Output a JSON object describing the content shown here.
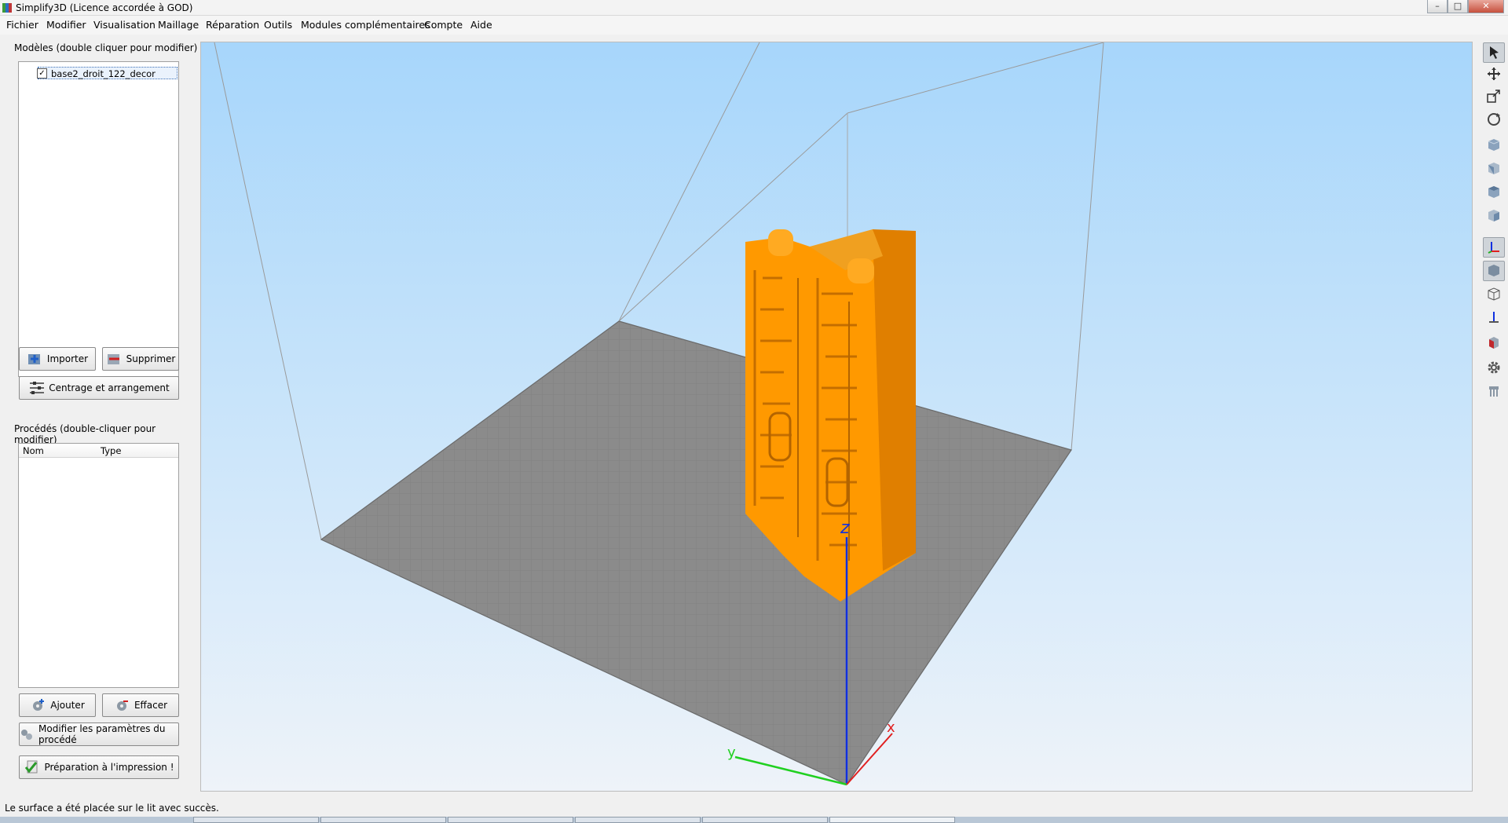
{
  "window": {
    "title": "Simplify3D (Licence accordée à GOD)",
    "min": "–",
    "max": "□",
    "close": "✕"
  },
  "menu": [
    "Fichier",
    "Modifier",
    "Visualisation",
    "Maillage",
    "Réparation",
    "Outils",
    "Modules complémentaires",
    "Compte",
    "Aide"
  ],
  "models": {
    "label": "Modèles (double cliquer pour modifier)",
    "items": [
      {
        "name": "base2_droit_122_decor",
        "checked": true
      }
    ],
    "import_label": "Importer",
    "delete_label": "Supprimer",
    "center_label": "Centrage et arrangement"
  },
  "processes": {
    "label": "Procédés (double-cliquer pour modifier)",
    "columns": [
      "Nom",
      "Type"
    ],
    "add_label": "Ajouter",
    "erase_label": "Effacer",
    "edit_label": "Modifier les paramètres du procédé",
    "prepare_label": "Préparation à l'impression !"
  },
  "status": "Le surface a été placée sur le lit avec succès.",
  "toolbar": [
    "select-icon",
    "move-icon",
    "scale-icon",
    "rotate-icon",
    "view-iso-icon",
    "view-front-icon",
    "view-top-icon",
    "view-side-icon",
    "axes-icon",
    "solid-view-icon",
    "wireframe-view-icon",
    "normals-icon",
    "cross-section-icon",
    "settings-icon",
    "supports-icon"
  ],
  "colors": {
    "model": "#ff9900",
    "bed": "#8b8b8b",
    "sky_top": "#a7d6fb",
    "axis_x": "#e02020",
    "axis_y": "#20d020",
    "axis_z": "#1030e0"
  }
}
